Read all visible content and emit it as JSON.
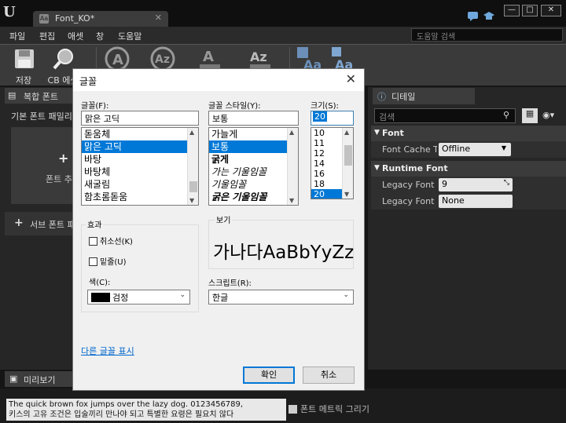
{
  "window": {
    "tab_title": "Font_KO*",
    "tab_icon": "Aa",
    "logo": "U"
  },
  "menu": [
    "파일",
    "편집",
    "애셋",
    "창",
    "도움말"
  ],
  "help_search": {
    "placeholder": "도움말 검색"
  },
  "toolbar": [
    {
      "label": "저장",
      "icon": "floppy-icon"
    },
    {
      "label": "CB 에셋",
      "icon": "magnifier-icon"
    },
    {
      "label": "",
      "icon": "font-a-icon"
    },
    {
      "label": "",
      "icon": "font-az-icon"
    },
    {
      "label": "",
      "icon": "font-a-upload-icon"
    },
    {
      "label": "",
      "icon": "font-az-sort-icon"
    },
    {
      "label": "",
      "icon": "font-aa-icon"
    },
    {
      "label": "",
      "icon": "font-aa-icon"
    }
  ],
  "left_panel": {
    "tab": "복합 폰트",
    "family_label": "기본 폰트 패밀리",
    "add_label": "폰트 추가",
    "sub_font": "서브 폰트 패밀리 추가",
    "preview_tab": "미리보기"
  },
  "right_panel": {
    "tab": "디테일",
    "search_placeholder": "검색",
    "sections": [
      {
        "title": "Font",
        "rows": [
          {
            "label": "Font Cache Type",
            "value": "Offline",
            "kind": "dropdown"
          }
        ]
      },
      {
        "title": "Runtime Font",
        "rows": [
          {
            "label": "Legacy Font Size",
            "value": "9",
            "kind": "spin"
          },
          {
            "label": "Legacy Font Name",
            "value": "None",
            "kind": "text"
          }
        ]
      }
    ]
  },
  "bottom": {
    "sample_line1": "The quick brown fox jumps over the lazy dog. 0123456789,",
    "sample_line2": "키스의 고유 조건은 입술끼리 만나야 되고 특별한 요령은 필요치 않다",
    "metric_label": "폰트 메트릭 그리기"
  },
  "dialog": {
    "title": "글꼴",
    "font_label": "글꼴(F):",
    "font_value": "맑은 고딕",
    "font_list": [
      "돋움체",
      "맑은 고딕",
      "바탕",
      "바탕체",
      "새굴림",
      "함초롬돋움"
    ],
    "font_selected": 1,
    "style_label": "글꼴 스타일(Y):",
    "style_value": "보통",
    "style_list": [
      "가늘게",
      "보통",
      "굵게",
      "가는 기울임꼴",
      "기울임꼴",
      "굵은 기울임꼴"
    ],
    "style_selected": 1,
    "size_label": "크기(S):",
    "size_value": "20",
    "size_list": [
      "10",
      "11",
      "12",
      "14",
      "16",
      "18",
      "20"
    ],
    "size_selected": 6,
    "effects_label": "효과",
    "strike_label": "취소선(K)",
    "underline_label": "밑줄(U)",
    "color_label": "색(C):",
    "color_value": "검정",
    "color_swatch": "#000000",
    "preview_label": "보기",
    "preview_text": "가나다AaBbYyZz",
    "script_label": "스크립트(R):",
    "script_value": "한글",
    "more_fonts": "다른 글꼴 표시",
    "ok": "확인",
    "cancel": "취소"
  }
}
